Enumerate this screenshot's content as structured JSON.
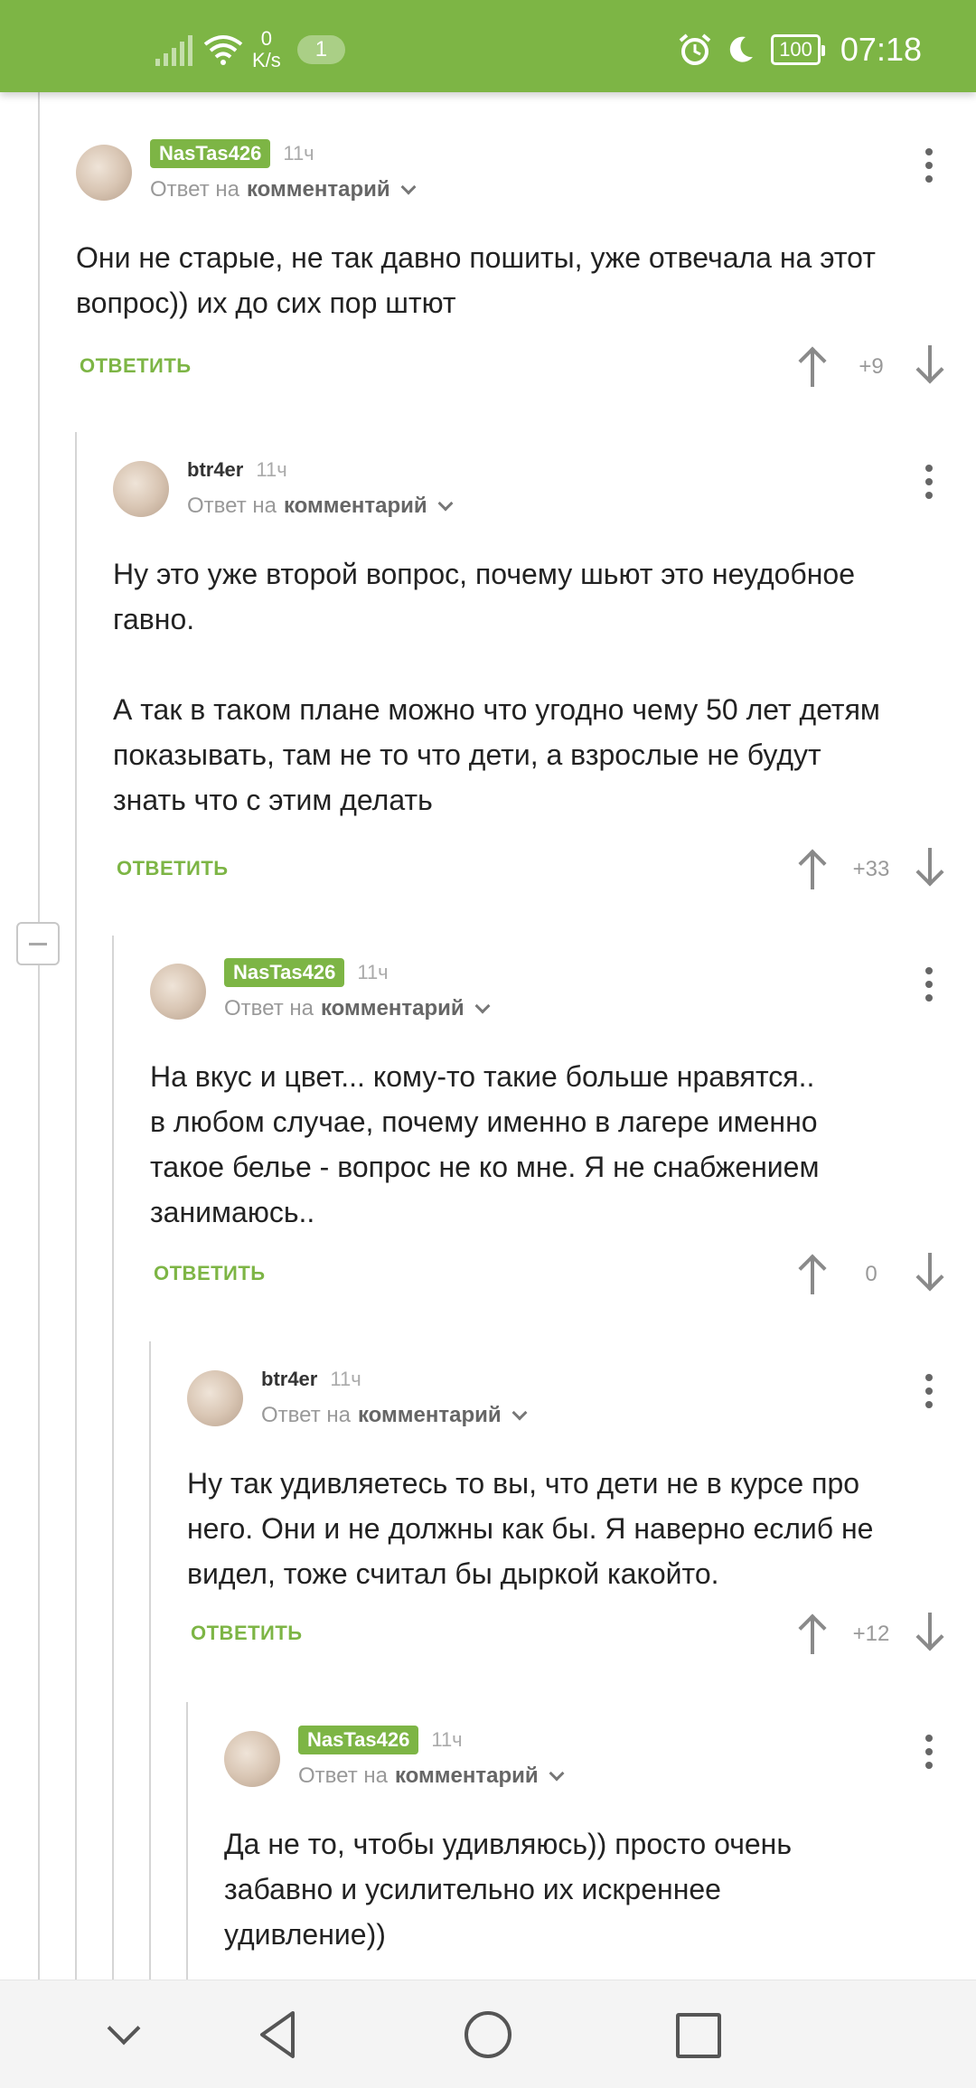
{
  "status_bar": {
    "net_speed_value": "0",
    "net_speed_unit": "K/s",
    "notification_count": "1",
    "battery": "100",
    "time": "07:18"
  },
  "comments": [
    {
      "username": "NasTas426",
      "username_style": "green",
      "time": "11ч",
      "reply_prefix": "Ответ на",
      "reply_target": "комментарий",
      "text_lines": [
        "Они не старые, не так давно пошиты, уже отвечала на этот",
        "вопрос)) их до сих пор штют"
      ],
      "reply_label": "ОТВЕТИТЬ",
      "score": "+9"
    },
    {
      "username": "btr4er",
      "username_style": "plain",
      "time": "11ч",
      "reply_prefix": "Ответ на",
      "reply_target": "комментарий",
      "text_lines": [
        "Ну это уже второй вопрос, почему шьют это неудобное",
        "гавно.",
        "",
        "А так в таком плане можно что угодно чему 50 лет детям",
        "показывать, там не то что дети, а взрослые не будут",
        "знать что с этим делать"
      ],
      "reply_label": "ОТВЕТИТЬ",
      "score": "+33"
    },
    {
      "username": "NasTas426",
      "username_style": "green",
      "time": "11ч",
      "reply_prefix": "Ответ на",
      "reply_target": "комментарий",
      "text_lines": [
        "На вкус и цвет... кому-то такие больше нравятся..",
        "в любом случае, почему именно в лагере именно",
        "такое белье - вопрос не ко мне. Я не снабжением",
        "занимаюсь.."
      ],
      "reply_label": "ОТВЕТИТЬ",
      "score": "0"
    },
    {
      "username": "btr4er",
      "username_style": "plain",
      "time": "11ч",
      "reply_prefix": "Ответ на",
      "reply_target": "комментарий",
      "text_lines": [
        "Ну так удивляетесь то вы, что дети не в курсе про",
        "него. Они и не должны как бы. Я наверно еслиб не",
        "видел, тоже считал бы дыркой какойто."
      ],
      "reply_label": "ОТВЕТИТЬ",
      "score": "+12"
    },
    {
      "username": "NasTas426",
      "username_style": "green",
      "time": "11ч",
      "reply_prefix": "Ответ на",
      "reply_target": "комментарий",
      "text_lines": [
        "Да не то, чтобы удивляюсь)) просто очень",
        "забавно и усилительно их искреннее",
        "удивление))"
      ],
      "reply_label": "",
      "score": ""
    }
  ]
}
